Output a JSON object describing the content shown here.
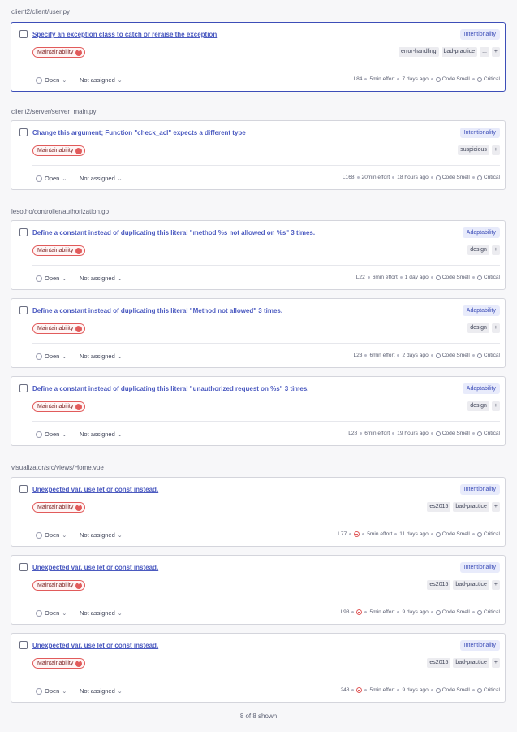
{
  "groups": [
    {
      "path": "client2/client/user.py"
    },
    {
      "path": "client2/server/server_main.py"
    },
    {
      "path": "lesotho/controller/authorization.go"
    },
    {
      "path": "visualizator/src/views/Home.vue"
    }
  ],
  "issues": [
    {
      "title": "Specify an exception class to catch or reraise the exception",
      "attribute": "Intentionality",
      "impact": "Maintainability",
      "tags": [
        "error-handling",
        "bad-practice",
        "...",
        "+"
      ],
      "status": "Open",
      "assignee": "Not assigned",
      "line": "L84",
      "effort": "5min effort",
      "age": "7 days ago",
      "type": "Code Smell",
      "severity": "Critical",
      "deprecated": false
    },
    {
      "title": "Change this argument; Function \"check_acl\" expects a different type",
      "attribute": "Intentionality",
      "impact": "Maintainability",
      "tags": [
        "suspicious",
        "+"
      ],
      "status": "Open",
      "assignee": "Not assigned",
      "line": "L168",
      "effort": "20min effort",
      "age": "18 hours ago",
      "type": "Code Smell",
      "severity": "Critical",
      "deprecated": false
    },
    {
      "title": "Define a constant instead of duplicating this literal \"method %s not allowed on %s\" 3 times.",
      "attribute": "Adaptability",
      "impact": "Maintainability",
      "tags": [
        "design",
        "+"
      ],
      "status": "Open",
      "assignee": "Not assigned",
      "line": "L22",
      "effort": "6min effort",
      "age": "1 day ago",
      "type": "Code Smell",
      "severity": "Critical",
      "deprecated": false
    },
    {
      "title": "Define a constant instead of duplicating this literal \"Method not allowed\" 3 times.",
      "attribute": "Adaptability",
      "impact": "Maintainability",
      "tags": [
        "design",
        "+"
      ],
      "status": "Open",
      "assignee": "Not assigned",
      "line": "L23",
      "effort": "6min effort",
      "age": "2 days ago",
      "type": "Code Smell",
      "severity": "Critical",
      "deprecated": false
    },
    {
      "title": "Define a constant instead of duplicating this literal \"unauthorized request on %s\" 3 times.",
      "attribute": "Adaptability",
      "impact": "Maintainability",
      "tags": [
        "design",
        "+"
      ],
      "status": "Open",
      "assignee": "Not assigned",
      "line": "L28",
      "effort": "6min effort",
      "age": "19 hours ago",
      "type": "Code Smell",
      "severity": "Critical",
      "deprecated": false
    },
    {
      "title": "Unexpected var, use let or const instead.",
      "attribute": "Intentionality",
      "impact": "Maintainability",
      "tags": [
        "es2015",
        "bad-practice",
        "+"
      ],
      "status": "Open",
      "assignee": "Not assigned",
      "line": "L77",
      "effort": "5min effort",
      "age": "11 days ago",
      "type": "Code Smell",
      "severity": "Critical",
      "deprecated": true
    },
    {
      "title": "Unexpected var, use let or const instead.",
      "attribute": "Intentionality",
      "impact": "Maintainability",
      "tags": [
        "es2015",
        "bad-practice",
        "+"
      ],
      "status": "Open",
      "assignee": "Not assigned",
      "line": "L98",
      "effort": "5min effort",
      "age": "9 days ago",
      "type": "Code Smell",
      "severity": "Critical",
      "deprecated": true
    },
    {
      "title": "Unexpected var, use let or const instead.",
      "attribute": "Intentionality",
      "impact": "Maintainability",
      "tags": [
        "es2015",
        "bad-practice",
        "+"
      ],
      "status": "Open",
      "assignee": "Not assigned",
      "line": "L248",
      "effort": "5min effort",
      "age": "9 days ago",
      "type": "Code Smell",
      "severity": "Critical",
      "deprecated": true
    }
  ],
  "footer": {
    "count_text": "8 of 8 shown"
  }
}
